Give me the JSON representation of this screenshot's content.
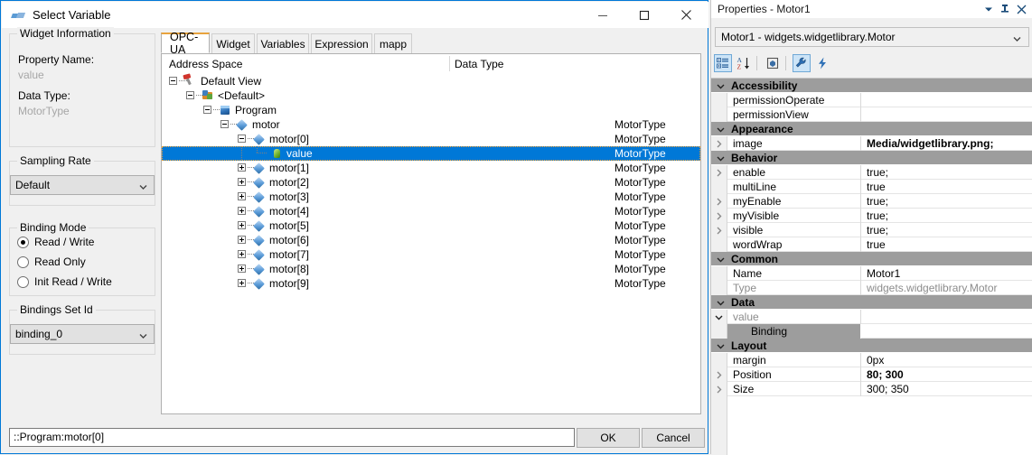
{
  "dialog": {
    "title": "Select Variable",
    "window_buttons": {
      "minimize": "—",
      "maximize": "□",
      "close": "✕"
    },
    "widget_information": {
      "legend": "Widget Information",
      "property_name_label": "Property Name:",
      "property_name_value": "value",
      "data_type_label": "Data Type:",
      "data_type_value": "MotorType"
    },
    "sampling_rate": {
      "legend": "Sampling Rate",
      "selected": "Default"
    },
    "binding_mode": {
      "legend": "Binding Mode",
      "options": [
        {
          "label": "Read / Write",
          "selected": true
        },
        {
          "label": "Read Only",
          "selected": false
        },
        {
          "label": "Init Read / Write",
          "selected": false
        }
      ]
    },
    "bindings_set_id": {
      "legend": "Bindings Set Id",
      "selected": "binding_0"
    },
    "tabs": [
      {
        "label": "OPC-UA",
        "active": true
      },
      {
        "label": "Widget",
        "active": false
      },
      {
        "label": "Variables",
        "active": false
      },
      {
        "label": "Expression",
        "active": false
      },
      {
        "label": "mapp",
        "active": false
      }
    ],
    "tree_columns": {
      "name": "Address Space",
      "datatype": "Data Type"
    },
    "tree_rows": [
      {
        "label": "Default View",
        "datatype": "",
        "depth": 0,
        "icon": "pin-icon",
        "expander": "minus",
        "selected": false
      },
      {
        "label": "<Default>",
        "datatype": "",
        "depth": 1,
        "icon": "folder-blue-icon",
        "expander": "minus",
        "selected": false
      },
      {
        "label": "Program",
        "datatype": "",
        "depth": 2,
        "icon": "cube-icon",
        "expander": "minus",
        "selected": false
      },
      {
        "label": "motor",
        "datatype": "MotorType",
        "depth": 3,
        "icon": "diamond-icon",
        "expander": "minus",
        "selected": false
      },
      {
        "label": "motor[0]",
        "datatype": "MotorType",
        "depth": 4,
        "icon": "diamond-icon",
        "expander": "minus",
        "selected": false
      },
      {
        "label": "value",
        "datatype": "MotorType",
        "depth": 5,
        "icon": "green-node-icon",
        "expander": "none",
        "selected": true
      },
      {
        "label": "motor[1]",
        "datatype": "MotorType",
        "depth": 4,
        "icon": "diamond-icon",
        "expander": "plus",
        "selected": false
      },
      {
        "label": "motor[2]",
        "datatype": "MotorType",
        "depth": 4,
        "icon": "diamond-icon",
        "expander": "plus",
        "selected": false
      },
      {
        "label": "motor[3]",
        "datatype": "MotorType",
        "depth": 4,
        "icon": "diamond-icon",
        "expander": "plus",
        "selected": false
      },
      {
        "label": "motor[4]",
        "datatype": "MotorType",
        "depth": 4,
        "icon": "diamond-icon",
        "expander": "plus",
        "selected": false
      },
      {
        "label": "motor[5]",
        "datatype": "MotorType",
        "depth": 4,
        "icon": "diamond-icon",
        "expander": "plus",
        "selected": false
      },
      {
        "label": "motor[6]",
        "datatype": "MotorType",
        "depth": 4,
        "icon": "diamond-icon",
        "expander": "plus",
        "selected": false
      },
      {
        "label": "motor[7]",
        "datatype": "MotorType",
        "depth": 4,
        "icon": "diamond-icon",
        "expander": "plus",
        "selected": false
      },
      {
        "label": "motor[8]",
        "datatype": "MotorType",
        "depth": 4,
        "icon": "diamond-icon",
        "expander": "plus",
        "selected": false
      },
      {
        "label": "motor[9]",
        "datatype": "MotorType",
        "depth": 4,
        "icon": "diamond-icon",
        "expander": "plus",
        "selected": false
      }
    ],
    "path_input": {
      "value": "::Program:motor[0]",
      "placeholder": ""
    },
    "ok_label": "OK",
    "cancel_label": "Cancel"
  },
  "properties": {
    "title": "Properties - Motor1",
    "title_buttons": {
      "dropdown": "▾",
      "pin": "⚑",
      "close": "✕"
    },
    "object_selector": "Motor1 - widgets.widgetlibrary.Motor",
    "toolbar": [
      {
        "name": "categorized-view",
        "active": true
      },
      {
        "name": "alphabetical-sort",
        "active": false
      },
      {
        "name": "object-browser",
        "active": false
      },
      {
        "name": "property-pages",
        "active": true
      },
      {
        "name": "events",
        "active": false
      }
    ],
    "rows": [
      {
        "kind": "category",
        "label": "Accessibility"
      },
      {
        "kind": "prop",
        "name": "permissionOperate",
        "value": "",
        "expander": false
      },
      {
        "kind": "prop",
        "name": "permissionView",
        "value": "",
        "expander": false
      },
      {
        "kind": "category",
        "label": "Appearance"
      },
      {
        "kind": "prop",
        "name": "image",
        "value": "Media/widgetlibrary.png;",
        "expander": true,
        "bold": true
      },
      {
        "kind": "category",
        "label": "Behavior"
      },
      {
        "kind": "prop",
        "name": "enable",
        "value": "true;",
        "expander": true
      },
      {
        "kind": "prop",
        "name": "multiLine",
        "value": "true",
        "expander": false
      },
      {
        "kind": "prop",
        "name": "myEnable",
        "value": "true;",
        "expander": true
      },
      {
        "kind": "prop",
        "name": "myVisible",
        "value": "true;",
        "expander": true
      },
      {
        "kind": "prop",
        "name": "visible",
        "value": "true;",
        "expander": true
      },
      {
        "kind": "prop",
        "name": "wordWrap",
        "value": "true",
        "expander": false
      },
      {
        "kind": "category",
        "label": "Common"
      },
      {
        "kind": "prop",
        "name": "Name",
        "value": "Motor1",
        "expander": false
      },
      {
        "kind": "prop",
        "name": "Type",
        "value": "widgets.widgetlibrary.Motor",
        "expander": false,
        "dim": true
      },
      {
        "kind": "category",
        "label": "Data"
      },
      {
        "kind": "prop",
        "name": "value",
        "value": "",
        "expander": "down",
        "dim_name": true
      },
      {
        "kind": "prop",
        "name": "Binding",
        "value": "",
        "expander": false,
        "sub": true
      },
      {
        "kind": "category",
        "label": "Layout"
      },
      {
        "kind": "prop",
        "name": "margin",
        "value": "0px",
        "expander": false
      },
      {
        "kind": "prop",
        "name": "Position",
        "value": "80; 300",
        "expander": true,
        "bold": true
      },
      {
        "kind": "prop",
        "name": "Size",
        "value": "300; 350",
        "expander": true
      }
    ]
  },
  "colors": {
    "accent_blue": "#0078d7",
    "selection_blue": "#0078d7",
    "category_gray": "#9d9d9d",
    "tab_accent": "#e8a33d",
    "panel_bg": "#f0f0f0"
  }
}
